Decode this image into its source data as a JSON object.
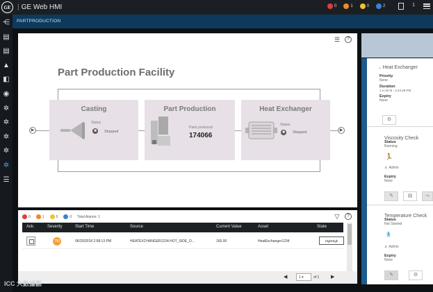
{
  "app": {
    "title": "GE Web HMI",
    "logo_text": "GE"
  },
  "alarm_counts": [
    {
      "value": "0",
      "color": "#e23b3b",
      "icon": "critical-alarm-icon"
    },
    {
      "value": "1",
      "color": "#f08a24",
      "icon": "high-alarm-icon"
    },
    {
      "value": "0",
      "color": "#f2c230",
      "icon": "medium-alarm-icon"
    },
    {
      "value": "2",
      "color": "#3b82d6",
      "icon": "low-alarm-icon"
    }
  ],
  "topbar": {
    "menu_count": "1"
  },
  "breadcrumb": "PARTPRODUCTION",
  "canvas": {
    "title": "Part Production Facility",
    "cards": [
      {
        "title": "Casting",
        "status_label": "Status",
        "status_value": "Stopped"
      },
      {
        "title": "Part Production",
        "metric_label": "Parts produced",
        "metric_value": "174066"
      },
      {
        "title": "Heat Exchanger",
        "status_label": "Status",
        "status_value": "Stopped"
      }
    ]
  },
  "alarm_panel": {
    "counts": [
      "0",
      "1",
      "0",
      "0"
    ],
    "total_label": "Total Alarms: 1",
    "columns": [
      "Ack.",
      "Severity",
      "Start Time",
      "Source",
      "Current Value",
      "Asset",
      "State"
    ],
    "rows": [
      {
        "severity": "750",
        "start_time": "06/20/2018 2:58:13 PM",
        "source": "HEATEXCHANGER1234.HOT_SIDE_O...",
        "current_value": "165.00",
        "asset": "HeatExchanger1234",
        "state": "HighHigh"
      }
    ],
    "pager": {
      "page": "1",
      "of_label": "of 1"
    }
  },
  "side_panel": {
    "alarm": {
      "title": "Heat Exchanger",
      "priority_label": "Priority",
      "priority_value": "None",
      "duration_label": "Duration",
      "duration_value": "1 H 26 M - 2:44:28 PM",
      "expiry_label": "Expiry",
      "expiry_value": "None"
    },
    "viscosity": {
      "title": "Viscosity Check",
      "status_label": "Status",
      "status_value": "Running",
      "user": "Admin",
      "expiry_label": "Expiry",
      "expiry_value": "None"
    },
    "temperature": {
      "title": "Temperature Check",
      "status_label": "Status",
      "status_value": "Not Started",
      "user": "Admin",
      "expiry_label": "Expiry",
      "expiry_value": "None"
    }
  },
  "watermark": "ICC 大數據觀"
}
